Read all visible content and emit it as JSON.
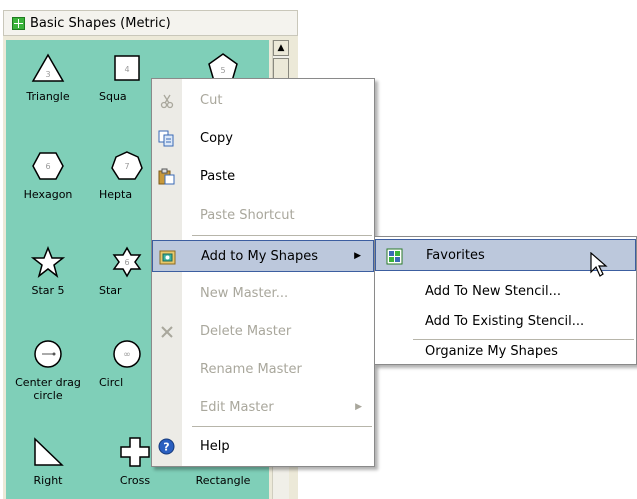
{
  "stencil": {
    "title": "Basic Shapes (Metric)",
    "shapes": [
      {
        "label": "Triangle",
        "num": "3"
      },
      {
        "label": "Squa",
        "num": "4"
      },
      {
        "label": "",
        "num": "5"
      },
      {
        "label": "Hexagon",
        "num": "6"
      },
      {
        "label": "Hepta",
        "num": "7"
      },
      {
        "label": "Star 5",
        "num": ""
      },
      {
        "label": "Star",
        "num": "6"
      },
      {
        "label": "Center drag circle",
        "num": ""
      },
      {
        "label": "Circl",
        "num": "∞"
      },
      {
        "label": "Right",
        "num": ""
      },
      {
        "label": "Cross",
        "num": ""
      },
      {
        "label": "Rectangle",
        "num": ""
      }
    ],
    "colors": {
      "area": "#7fcfb8"
    }
  },
  "context_menu": {
    "items": [
      {
        "label": "Cut",
        "enabled": false,
        "icon": "scissors-icon"
      },
      {
        "label": "Copy",
        "enabled": true,
        "icon": "copy-icon"
      },
      {
        "label": "Paste",
        "enabled": true,
        "icon": "paste-icon"
      },
      {
        "label": "Paste Shortcut",
        "enabled": false,
        "icon": ""
      },
      {
        "label": "Add to My Shapes",
        "enabled": true,
        "icon": "add-to-my-shapes-icon",
        "submenu": true,
        "highlighted": true
      },
      {
        "label": "New Master...",
        "enabled": false,
        "icon": ""
      },
      {
        "label": "Delete Master",
        "enabled": false,
        "icon": "delete-x-icon"
      },
      {
        "label": "Rename Master",
        "enabled": false,
        "icon": ""
      },
      {
        "label": "Edit Master",
        "enabled": false,
        "icon": "",
        "submenu": true
      },
      {
        "label": "Help",
        "enabled": true,
        "icon": "help-icon"
      }
    ]
  },
  "submenu": {
    "items": [
      {
        "label": "Favorites",
        "highlighted": true,
        "icon": "favorites-stencil-icon"
      },
      {
        "label": "Add To New Stencil..."
      },
      {
        "label": "Add To Existing Stencil..."
      },
      {
        "label": "Organize My Shapes"
      }
    ]
  },
  "cursor": "arrow-pointer-icon"
}
